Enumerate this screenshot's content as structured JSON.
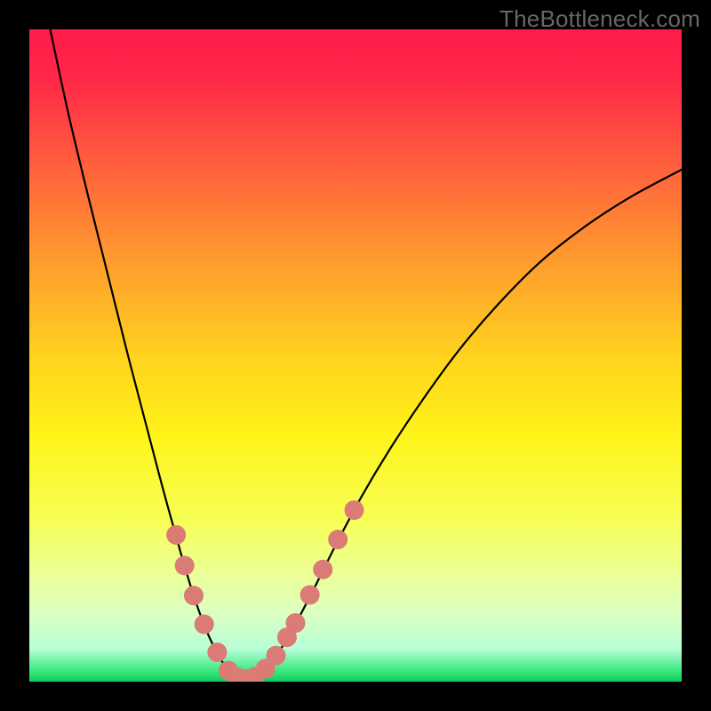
{
  "watermark": "TheBottleneck.com",
  "chart_data": {
    "type": "line",
    "title": "",
    "xlabel": "",
    "ylabel": "",
    "xlim": [
      0,
      1
    ],
    "ylim": [
      0,
      1
    ],
    "grid": false,
    "legend": false,
    "background": {
      "type": "vertical-gradient",
      "stops": [
        {
          "offset": 0.0,
          "color": "#ff1a4a"
        },
        {
          "offset": 0.08,
          "color": "#ff2a47"
        },
        {
          "offset": 0.2,
          "color": "#ff5c3e"
        },
        {
          "offset": 0.35,
          "color": "#ff9a2e"
        },
        {
          "offset": 0.5,
          "color": "#ffd21e"
        },
        {
          "offset": 0.62,
          "color": "#fff318"
        },
        {
          "offset": 0.75,
          "color": "#f7ff55"
        },
        {
          "offset": 0.84,
          "color": "#eaff9a"
        },
        {
          "offset": 0.9,
          "color": "#d9ffc3"
        },
        {
          "offset": 0.95,
          "color": "#b8ffd8"
        },
        {
          "offset": 0.985,
          "color": "#35e87a"
        },
        {
          "offset": 1.0,
          "color": "#12c95c"
        }
      ]
    },
    "series": [
      {
        "name": "curve",
        "stroke": "#000000",
        "points": [
          {
            "x": 0.032,
            "y": 1.0
          },
          {
            "x": 0.06,
            "y": 0.87
          },
          {
            "x": 0.09,
            "y": 0.745
          },
          {
            "x": 0.12,
            "y": 0.625
          },
          {
            "x": 0.15,
            "y": 0.505
          },
          {
            "x": 0.18,
            "y": 0.39
          },
          {
            "x": 0.205,
            "y": 0.295
          },
          {
            "x": 0.23,
            "y": 0.205
          },
          {
            "x": 0.25,
            "y": 0.138
          },
          {
            "x": 0.27,
            "y": 0.082
          },
          {
            "x": 0.29,
            "y": 0.04
          },
          {
            "x": 0.305,
            "y": 0.018
          },
          {
            "x": 0.318,
            "y": 0.007
          },
          {
            "x": 0.33,
            "y": 0.003
          },
          {
            "x": 0.345,
            "y": 0.006
          },
          {
            "x": 0.36,
            "y": 0.018
          },
          {
            "x": 0.38,
            "y": 0.042
          },
          {
            "x": 0.405,
            "y": 0.083
          },
          {
            "x": 0.435,
            "y": 0.14
          },
          {
            "x": 0.47,
            "y": 0.21
          },
          {
            "x": 0.51,
            "y": 0.285
          },
          {
            "x": 0.555,
            "y": 0.36
          },
          {
            "x": 0.605,
            "y": 0.435
          },
          {
            "x": 0.66,
            "y": 0.51
          },
          {
            "x": 0.72,
            "y": 0.58
          },
          {
            "x": 0.785,
            "y": 0.645
          },
          {
            "x": 0.855,
            "y": 0.7
          },
          {
            "x": 0.925,
            "y": 0.745
          },
          {
            "x": 1.0,
            "y": 0.785
          }
        ]
      }
    ],
    "markers": {
      "color": "#da7b76",
      "radius_px": 11,
      "points": [
        {
          "x": 0.225,
          "y": 0.225
        },
        {
          "x": 0.238,
          "y": 0.178
        },
        {
          "x": 0.252,
          "y": 0.132
        },
        {
          "x": 0.268,
          "y": 0.088
        },
        {
          "x": 0.288,
          "y": 0.045
        },
        {
          "x": 0.305,
          "y": 0.017
        },
        {
          "x": 0.318,
          "y": 0.007
        },
        {
          "x": 0.332,
          "y": 0.004
        },
        {
          "x": 0.346,
          "y": 0.008
        },
        {
          "x": 0.362,
          "y": 0.02
        },
        {
          "x": 0.378,
          "y": 0.04
        },
        {
          "x": 0.395,
          "y": 0.068
        },
        {
          "x": 0.408,
          "y": 0.09
        },
        {
          "x": 0.43,
          "y": 0.133
        },
        {
          "x": 0.45,
          "y": 0.172
        },
        {
          "x": 0.473,
          "y": 0.218
        },
        {
          "x": 0.498,
          "y": 0.263
        }
      ]
    }
  }
}
